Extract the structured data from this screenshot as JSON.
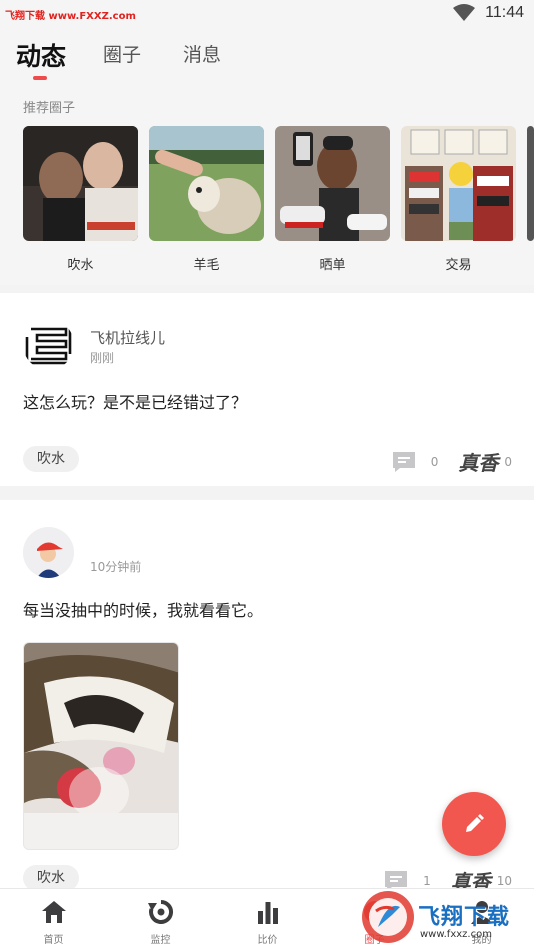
{
  "watermark": {
    "top_left": "飞翔下载 www.FXXZ.com",
    "bottom_right": "飞翔下载",
    "bottom_right_url": "www.fxxz.com"
  },
  "status": {
    "time": "11:44"
  },
  "header": {
    "tabs": [
      {
        "label": "动态"
      },
      {
        "label": "圈子"
      },
      {
        "label": "消息"
      }
    ]
  },
  "recommended": {
    "title": "推荐圈子",
    "circles": [
      {
        "label": "吹水"
      },
      {
        "label": "羊毛"
      },
      {
        "label": "晒单"
      },
      {
        "label": "交易"
      }
    ]
  },
  "posts": [
    {
      "username": "飞机拉线儿",
      "time": "刚刚",
      "content": "这怎么玩？是不是已经错过了？",
      "tag": "吹水",
      "comments": "0",
      "zhenxiang_label": "真香",
      "likes": "0"
    },
    {
      "username": "",
      "time": "10分钟前",
      "content": "每当没抽中的时候，我就看看它。",
      "tag": "吹水",
      "comments": "1",
      "zhenxiang_label": "真香",
      "likes": "10"
    }
  ],
  "bottom_nav": {
    "items": [
      {
        "label": "首页",
        "icon": "home-icon"
      },
      {
        "label": "监控",
        "icon": "refresh-icon"
      },
      {
        "label": "比价",
        "icon": "bar-chart-icon"
      },
      {
        "label": "圈子",
        "icon": "circle-icon"
      },
      {
        "label": "我的",
        "icon": "user-icon"
      }
    ]
  },
  "colors": {
    "accent": "#ef4b4c",
    "fab": "#f1574f",
    "background": "#f3f3f4"
  }
}
